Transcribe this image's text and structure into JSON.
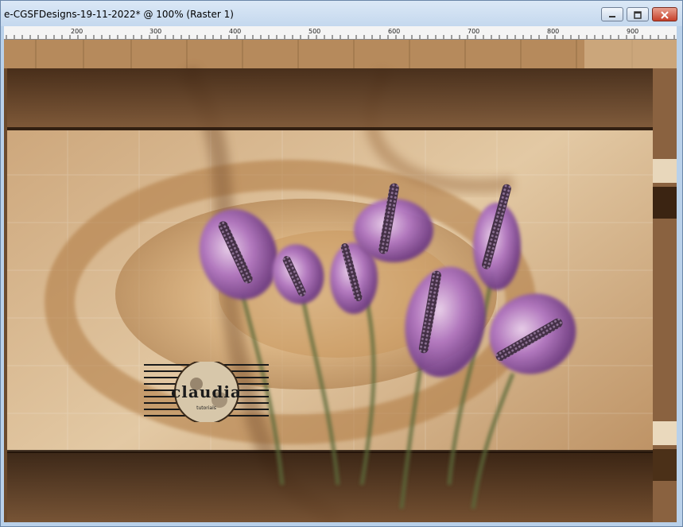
{
  "window": {
    "title": "e-CGSFDesigns-19-11-2022* @ 100% (Raster 1)",
    "buttons": {
      "minimize": "minimize",
      "maximize": "maximize",
      "close": "close"
    }
  },
  "ruler": {
    "labels": [
      "200",
      "300",
      "400",
      "500",
      "600",
      "700",
      "800",
      "900"
    ]
  },
  "canvas": {
    "logo_text": "claudia",
    "logo_subtext": "tutorials"
  },
  "colors": {
    "accent_close": "#c7402a",
    "canvas_brown": "#6b4a2c",
    "canvas_tan": "#c79f70",
    "flower_purple": "#a466b4"
  }
}
